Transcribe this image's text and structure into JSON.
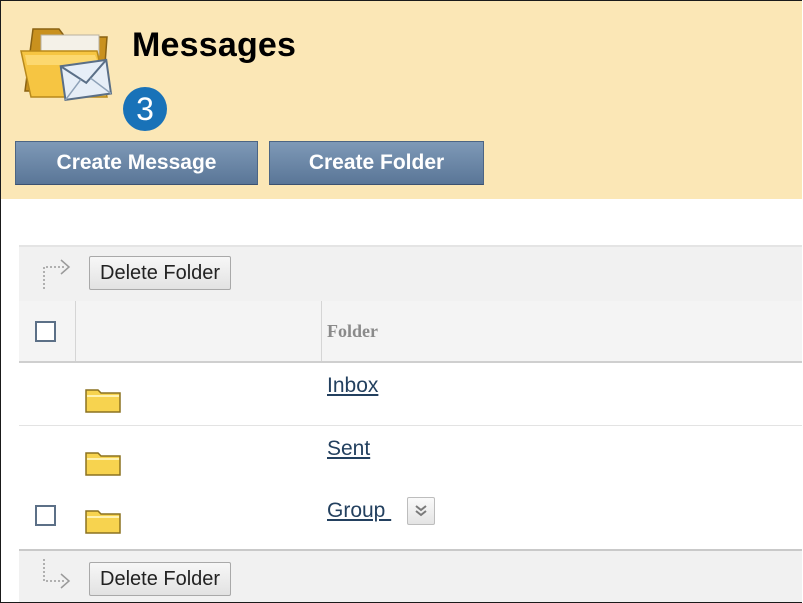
{
  "header": {
    "title": "Messages",
    "badge_count": "3",
    "icon": "folder-mail-icon",
    "background": "#fbe7b6",
    "badge_color": "#1972b8"
  },
  "actions": {
    "create_message": "Create Message",
    "create_folder": "Create Folder",
    "button_color": "#6a86a7"
  },
  "toolbar": {
    "delete_folder": "Delete Folder",
    "arrow_icon": "select-arrow-icon"
  },
  "table": {
    "columns": [
      "",
      "",
      "Folder"
    ],
    "rows": [
      {
        "name": "Inbox",
        "selectable": false,
        "has_menu": false,
        "icon": "folder-icon"
      },
      {
        "name": "Sent",
        "selectable": false,
        "has_menu": false,
        "icon": "folder-icon"
      },
      {
        "name": "Group ",
        "selectable": true,
        "has_menu": true,
        "icon": "folder-icon",
        "menu_icon": "chevron-down-icon"
      }
    ]
  },
  "footer_toolbar": {
    "delete_folder": "Delete Folder"
  }
}
